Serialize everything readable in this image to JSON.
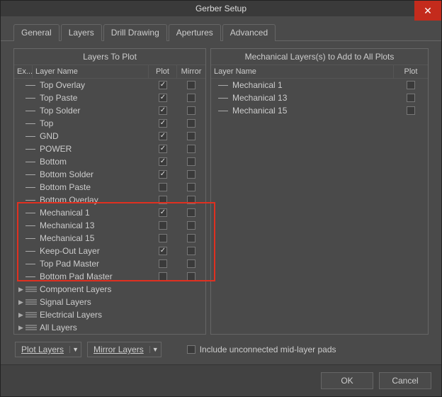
{
  "window": {
    "title": "Gerber Setup"
  },
  "tabs": [
    "General",
    "Layers",
    "Drill Drawing",
    "Apertures",
    "Advanced"
  ],
  "activeTab": 1,
  "leftPanel": {
    "title": "Layers To Plot",
    "headers": {
      "ex": "Ex...",
      "name": "Layer Name",
      "plot": "Plot",
      "mirror": "Mirror"
    },
    "layers": [
      {
        "name": "Top Overlay",
        "plot": true,
        "mirror": false
      },
      {
        "name": "Top Paste",
        "plot": true,
        "mirror": false
      },
      {
        "name": "Top Solder",
        "plot": true,
        "mirror": false
      },
      {
        "name": "Top",
        "plot": true,
        "mirror": false
      },
      {
        "name": "GND",
        "plot": true,
        "mirror": false
      },
      {
        "name": "POWER",
        "plot": true,
        "mirror": false
      },
      {
        "name": "Bottom",
        "plot": true,
        "mirror": false
      },
      {
        "name": "Bottom Solder",
        "plot": true,
        "mirror": false
      },
      {
        "name": "Bottom Paste",
        "plot": false,
        "mirror": false
      },
      {
        "name": "Bottom Overlay",
        "plot": false,
        "mirror": false
      },
      {
        "name": "Mechanical 1",
        "plot": true,
        "mirror": false
      },
      {
        "name": "Mechanical 13",
        "plot": false,
        "mirror": false
      },
      {
        "name": "Mechanical 15",
        "plot": false,
        "mirror": false
      },
      {
        "name": "Keep-Out Layer",
        "plot": true,
        "mirror": false
      },
      {
        "name": "Top Pad Master",
        "plot": false,
        "mirror": false
      },
      {
        "name": "Bottom Pad Master",
        "plot": false,
        "mirror": false
      }
    ],
    "groups": [
      {
        "name": "Component Layers"
      },
      {
        "name": "Signal Layers"
      },
      {
        "name": "Electrical Layers"
      },
      {
        "name": "All Layers"
      }
    ]
  },
  "rightPanel": {
    "title": "Mechanical Layers(s) to Add to All Plots",
    "headers": {
      "name": "Layer Name",
      "plot": "Plot"
    },
    "layers": [
      {
        "name": "Mechanical 1",
        "plot": false
      },
      {
        "name": "Mechanical 13",
        "plot": false
      },
      {
        "name": "Mechanical 15",
        "plot": false
      }
    ]
  },
  "controls": {
    "plotLayers": "Plot Layers",
    "mirrorLayers": "Mirror Layers",
    "includeMid": "Include unconnected mid-layer pads",
    "includeMidChecked": false
  },
  "buttons": {
    "ok": "OK",
    "cancel": "Cancel"
  }
}
